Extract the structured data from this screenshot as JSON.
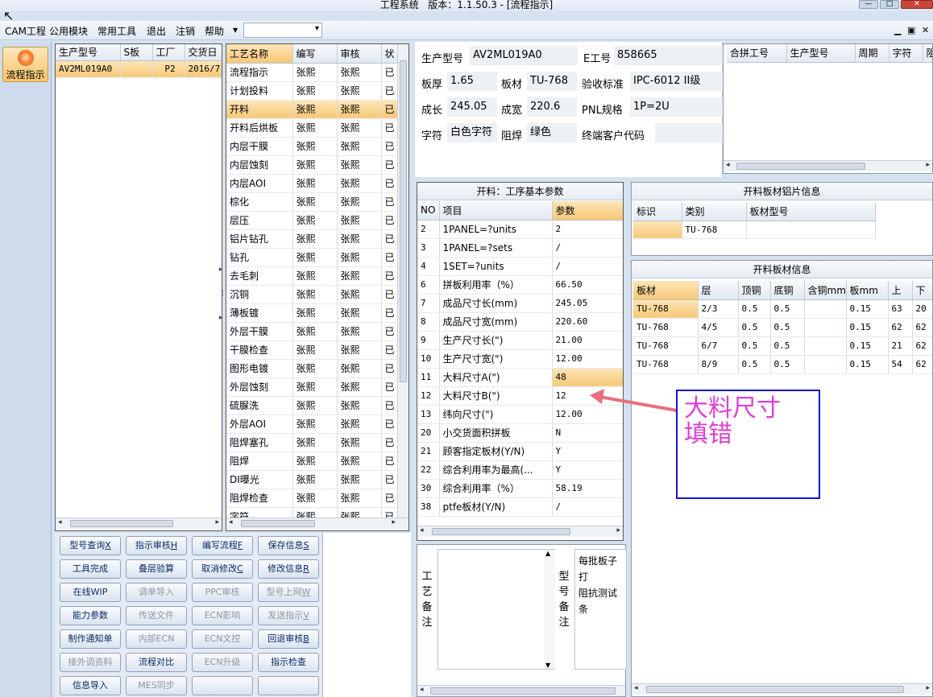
{
  "window": {
    "title": "工程系统",
    "version_label": "版本：1.1.50.3 - [流程指示]"
  },
  "menu": {
    "items": [
      "CAM工程",
      "公用模块",
      "常用工具",
      "退出",
      "注销",
      "帮助"
    ],
    "caret": "▾",
    "combo_value": ""
  },
  "leftbar": {
    "flow_label": "流程指示"
  },
  "orders": {
    "headers": [
      "生产型号",
      "S板",
      "工厂",
      "交货日"
    ],
    "rows": [
      [
        "AV2ML019A0",
        "",
        "P2",
        "2016/7"
      ]
    ]
  },
  "processes": {
    "headers": [
      "工艺名称",
      "编写",
      "审核",
      "状"
    ],
    "rows": [
      [
        "流程指示",
        "张熙",
        "张熙",
        "已"
      ],
      [
        "计划投料",
        "张熙",
        "张熙",
        "已"
      ],
      [
        "开料",
        "张熙",
        "张熙",
        "已"
      ],
      [
        "开料后烘板",
        "张熙",
        "张熙",
        "已"
      ],
      [
        "内层干膜",
        "张熙",
        "张熙",
        "已"
      ],
      [
        "内层蚀刻",
        "张熙",
        "张熙",
        "已"
      ],
      [
        "内层AOI",
        "张熙",
        "张熙",
        "已"
      ],
      [
        "棕化",
        "张熙",
        "张熙",
        "已"
      ],
      [
        "层压",
        "张熙",
        "张熙",
        "已"
      ],
      [
        "铝片钻孔",
        "张熙",
        "张熙",
        "已"
      ],
      [
        "钻孔",
        "张熙",
        "张熙",
        "已"
      ],
      [
        "去毛刺",
        "张熙",
        "张熙",
        "已"
      ],
      [
        "沉铜",
        "张熙",
        "张熙",
        "已"
      ],
      [
        "薄板镀",
        "张熙",
        "张熙",
        "已"
      ],
      [
        "外层干膜",
        "张熙",
        "张熙",
        "已"
      ],
      [
        "干膜检查",
        "张熙",
        "张熙",
        "已"
      ],
      [
        "图形电镀",
        "张熙",
        "张熙",
        "已"
      ],
      [
        "外层蚀刻",
        "张熙",
        "张熙",
        "已"
      ],
      [
        "硫脲洗",
        "张熙",
        "张熙",
        "已"
      ],
      [
        "外层AOI",
        "张熙",
        "张熙",
        "已"
      ],
      [
        "阻焊塞孔",
        "张熙",
        "张熙",
        "已"
      ],
      [
        "阻焊",
        "张熙",
        "张熙",
        "已"
      ],
      [
        "DI曝光",
        "张熙",
        "张熙",
        "已"
      ],
      [
        "阻焊检查",
        "张熙",
        "张熙",
        "已"
      ],
      [
        "字符",
        "张熙",
        "张熙",
        "已"
      ]
    ]
  },
  "info": {
    "model_label": "生产型号",
    "model": "AV2ML019A0",
    "eno_label": "E工号",
    "eno": "858665",
    "thick_label": "板厚",
    "thick": "1.65",
    "mat_label": "板材",
    "mat": "TU-768",
    "std_label": "验收标准",
    "std": "IPC-6012 II级",
    "len_label": "成长",
    "len": "245.05",
    "wid_label": "成宽",
    "wid": "220.6",
    "pnl_label": "PNL规格",
    "pnl": "1P=2U",
    "char_label": "字符",
    "char": "白色字符",
    "mask_label": "阻焊",
    "mask": "绿色",
    "cust_label": "终端客户代码",
    "cust": ""
  },
  "merge": {
    "headers": [
      "合拼工号",
      "生产型号",
      "周期",
      "字符",
      "阻焊"
    ]
  },
  "params": {
    "title": "开料：工序基本参数",
    "headers": [
      "NO",
      "项目",
      "参数"
    ],
    "rows": [
      [
        "2",
        "1PANEL=?units",
        "2"
      ],
      [
        "3",
        "1PANEL=?sets",
        "/"
      ],
      [
        "4",
        "1SET=?units",
        "/"
      ],
      [
        "6",
        "拼板利用率（%）",
        "66.50"
      ],
      [
        "7",
        "成品尺寸长(mm)",
        "245.05"
      ],
      [
        "8",
        "成品尺寸宽(mm)",
        "220.60"
      ],
      [
        "9",
        "生产尺寸长(\")",
        "21.00"
      ],
      [
        "10",
        "生产尺寸宽(\")",
        "12.00"
      ],
      [
        "11",
        "大料尺寸A(\")",
        "48"
      ],
      [
        "12",
        "大料尺寸B(\")",
        "12"
      ],
      [
        "13",
        "纬向尺寸(\")",
        "12.00"
      ],
      [
        "20",
        "小交货面积拼板",
        "N"
      ],
      [
        "21",
        "顾客指定板材(Y/N)",
        "Y"
      ],
      [
        "22",
        "综合利用率为最高(...",
        "Y"
      ],
      [
        "30",
        "综合利用率（%）",
        "58.19"
      ],
      [
        "38",
        "ptfe板材(Y/N)",
        "/"
      ]
    ]
  },
  "alu": {
    "title": "开料板材铝片信息",
    "headers": [
      "标识",
      "类别",
      "板材型号"
    ],
    "rows": [
      [
        "",
        "TU-768",
        ""
      ]
    ]
  },
  "board": {
    "title": "开料板材信息",
    "headers": [
      "板材",
      "层",
      "顶铜",
      "底铜",
      "含铜mm",
      "板mm",
      "上",
      "下"
    ],
    "rows": [
      [
        "TU-768",
        "2/3",
        "0.5",
        "0.5",
        "",
        "0.15",
        "63",
        "20"
      ],
      [
        "TU-768",
        "4/5",
        "0.5",
        "0.5",
        "",
        "0.15",
        "62",
        "62"
      ],
      [
        "TU-768",
        "6/7",
        "0.5",
        "0.5",
        "",
        "0.15",
        "21",
        "62"
      ],
      [
        "TU-768",
        "8/9",
        "0.5",
        "0.5",
        "",
        "0.15",
        "54",
        "62"
      ]
    ]
  },
  "buttons": [
    {
      "text": "型号查询",
      "key": "X",
      "enabled": true
    },
    {
      "text": "指示审核",
      "key": "H",
      "enabled": true
    },
    {
      "text": "编写流程",
      "key": "F",
      "enabled": true
    },
    {
      "text": "保存信息",
      "key": "S",
      "enabled": true
    },
    {
      "text": "工具完成",
      "key": "",
      "enabled": true
    },
    {
      "text": "叠层验算",
      "key": "",
      "enabled": true
    },
    {
      "text": "取消修改",
      "key": "C",
      "enabled": true
    },
    {
      "text": "修改信息",
      "key": "R",
      "enabled": true
    },
    {
      "text": "在线WIP",
      "key": "",
      "enabled": true
    },
    {
      "text": "调单导入",
      "key": "",
      "enabled": false
    },
    {
      "text": "PPC审核",
      "key": "",
      "enabled": false
    },
    {
      "text": "型号上网",
      "key": "W",
      "enabled": false
    },
    {
      "text": "能力参数",
      "key": "",
      "enabled": true
    },
    {
      "text": "传送文件",
      "key": "",
      "enabled": false
    },
    {
      "text": "ECN影响",
      "key": "",
      "enabled": false
    },
    {
      "text": "发送指示",
      "key": "V",
      "enabled": false
    },
    {
      "text": "制作通知单",
      "key": "",
      "enabled": true
    },
    {
      "text": "内部ECN",
      "key": "",
      "enabled": false
    },
    {
      "text": "ECN文控",
      "key": "",
      "enabled": false
    },
    {
      "text": "回退审核",
      "key": "B",
      "enabled": true
    },
    {
      "text": "接外调资料",
      "key": "",
      "enabled": false
    },
    {
      "text": "流程对比",
      "key": "",
      "enabled": true
    },
    {
      "text": "ECN升级",
      "key": "",
      "enabled": false
    },
    {
      "text": "指示检查",
      "key": "",
      "enabled": true
    },
    {
      "text": "信息导入",
      "key": "",
      "enabled": true
    },
    {
      "text": "MES同步",
      "key": "",
      "enabled": false
    },
    {
      "text": "",
      "key": "",
      "enabled": true
    },
    {
      "text": "",
      "key": "",
      "enabled": true
    }
  ],
  "remarks": {
    "process_label": "工艺备注",
    "model_label": "型号备注",
    "model_text": "每批板子打\n阻抗测试条"
  },
  "annotation": {
    "text": "大料尺寸\n填错",
    "color": "#e040d0",
    "arrow_color": "#e8707e"
  }
}
